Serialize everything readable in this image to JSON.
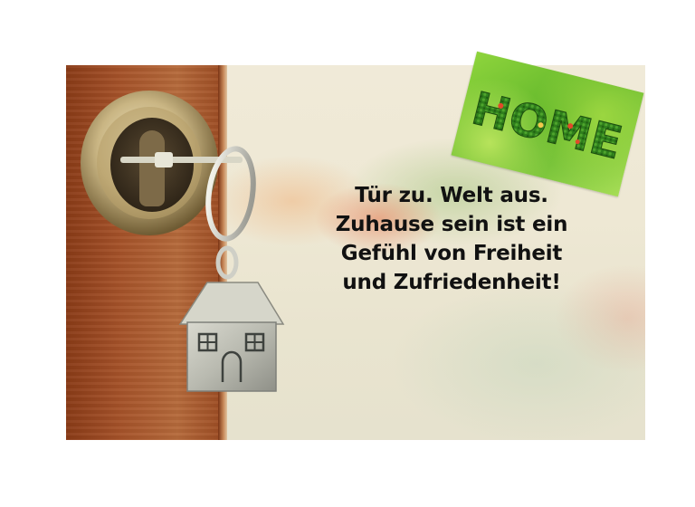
{
  "quote": {
    "lines": [
      "Tür zu. Welt aus.",
      "Zuhause sein ist ein",
      "Gefühl von Freiheit",
      "und Zufriedenheit!"
    ]
  },
  "home_card": {
    "text": "HOME"
  },
  "colors": {
    "door_wood": "#a6532a",
    "background": "#eee8d4",
    "text": "#111111",
    "grass": "#6cc033"
  }
}
